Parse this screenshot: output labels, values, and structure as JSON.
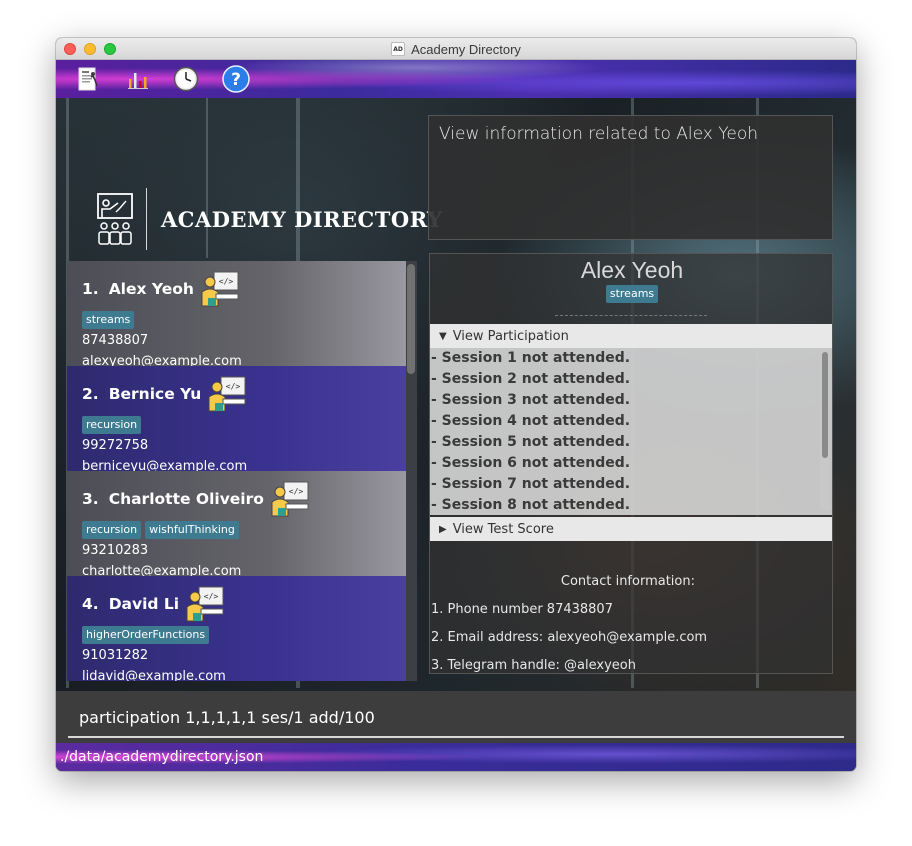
{
  "window": {
    "title": "Academy Directory",
    "app_icon_text": "AD"
  },
  "toolbar": {
    "icons": [
      "exit-icon",
      "chart-icon",
      "clock-icon",
      "help-icon"
    ],
    "help_glyph": "?"
  },
  "logo": {
    "text": "ACADEMY DIRECTORY"
  },
  "info": {
    "text": "View information related to Alex Yeoh"
  },
  "students": [
    {
      "index": "1.",
      "name": "Alex Yeoh",
      "tags": [
        "streams"
      ],
      "phone": "87438807",
      "email": "alexyeoh@example.com"
    },
    {
      "index": "2.",
      "name": "Bernice Yu",
      "tags": [
        "recursion"
      ],
      "phone": "99272758",
      "email": "berniceyu@example.com"
    },
    {
      "index": "3.",
      "name": "Charlotte Oliveiro",
      "tags": [
        "recursion",
        "wishfulThinking"
      ],
      "phone": "93210283",
      "email": "charlotte@example.com"
    },
    {
      "index": "4.",
      "name": "David Li",
      "tags": [
        "higherOrderFunctions"
      ],
      "phone": "91031282",
      "email": "lidavid@example.com"
    }
  ],
  "detail": {
    "name": "Alex Yeoh",
    "tag": "streams",
    "participation_label": "View Participation",
    "test_score_label": "View Test Score",
    "sessions": [
      "- Session 1 not attended.",
      "- Session 2 not attended.",
      "- Session 3 not attended.",
      "- Session 4 not attended.",
      "- Session 5 not attended.",
      "- Session 6 not attended.",
      "- Session 7 not attended.",
      "- Session 8 not attended."
    ],
    "contact_title": "Contact information:",
    "contact_lines": [
      "1. Phone number 87438807",
      "2. Email address: alexyeoh@example.com",
      "3. Telegram handle: @alexyeoh"
    ]
  },
  "command": {
    "value": "participation 1,1,1,1,1 ses/1 add/100"
  },
  "status": {
    "path": "./data/academydirectory.json"
  },
  "colors": {
    "tag": "#3e7b91",
    "card_even": "#3a3290",
    "card_odd": "#646469"
  }
}
